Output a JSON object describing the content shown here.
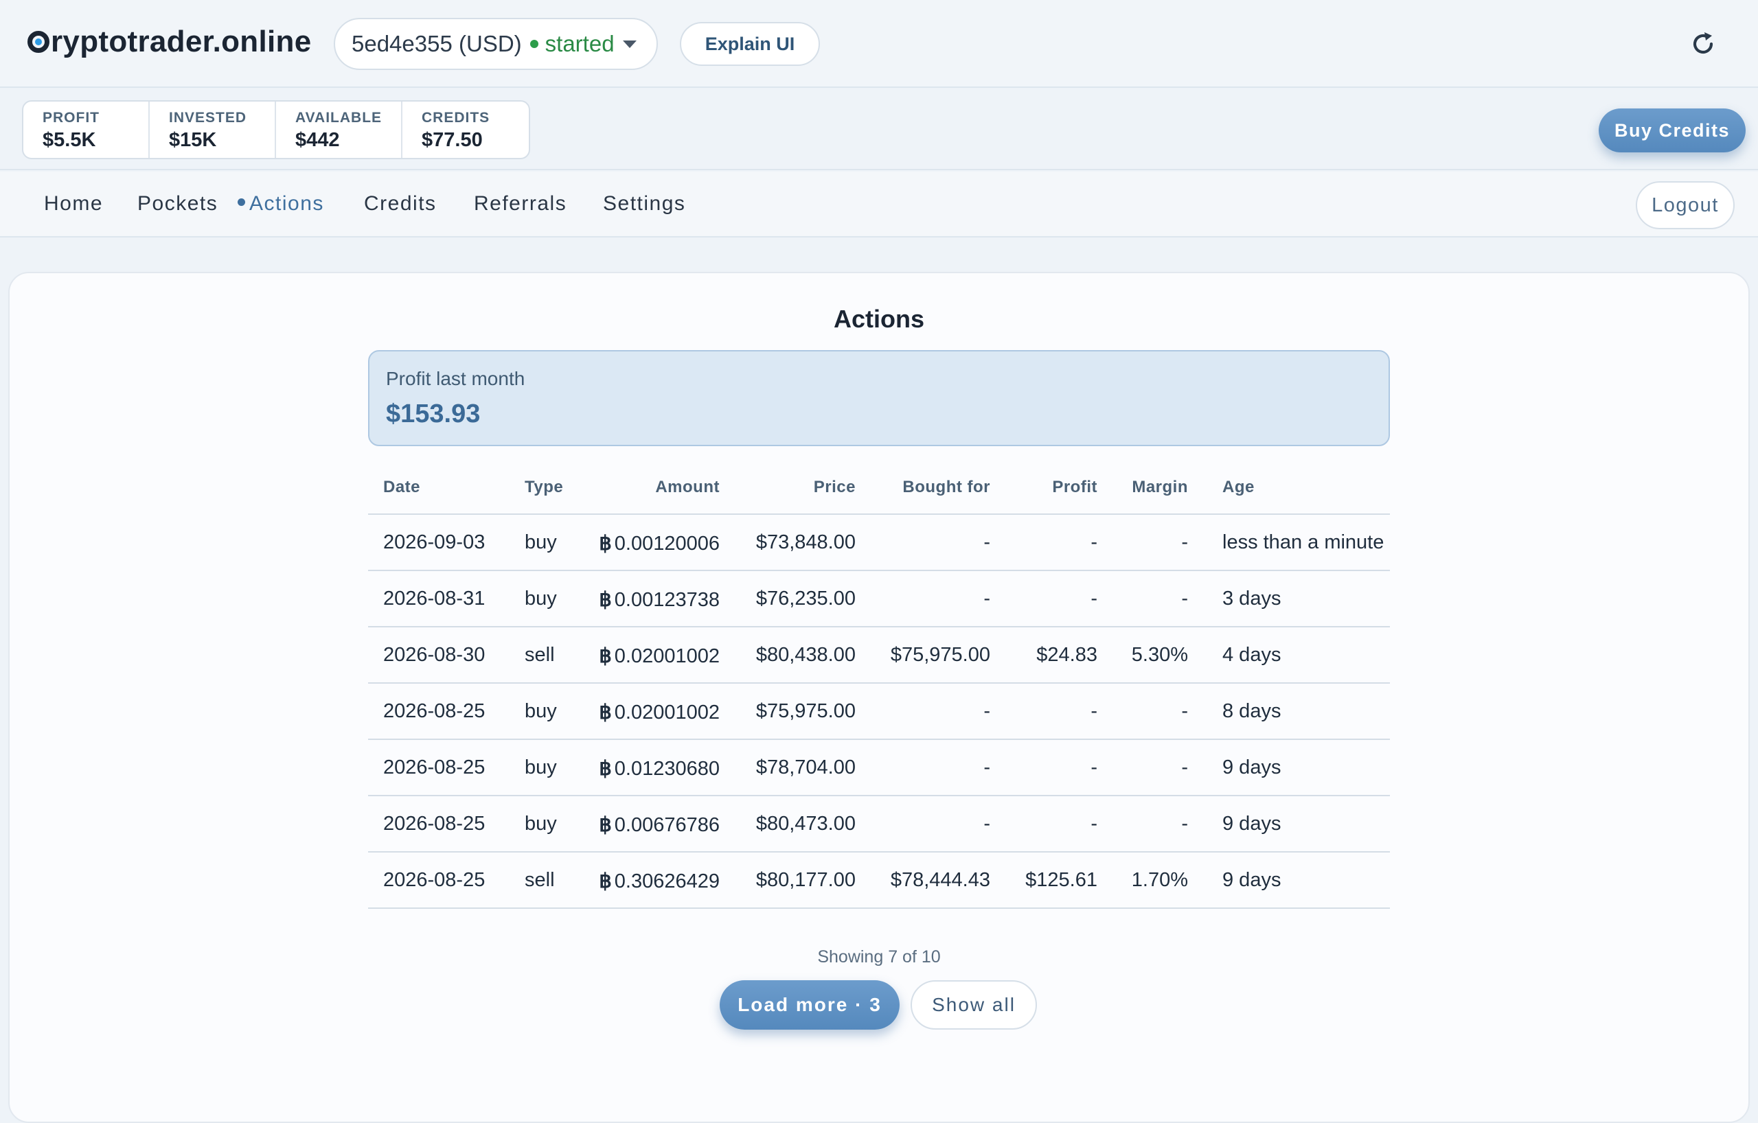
{
  "header": {
    "logo_text": "ryptotrader.online",
    "pocket": {
      "id": "5ed4e355 (USD)",
      "status": "started"
    },
    "explain_label": "Explain UI"
  },
  "stats": [
    {
      "label": "PROFIT",
      "value": "$5.5K"
    },
    {
      "label": "INVESTED",
      "value": "$15K"
    },
    {
      "label": "AVAILABLE",
      "value": "$442"
    },
    {
      "label": "CREDITS",
      "value": "$77.50"
    }
  ],
  "buy_credits_label": "Buy Credits",
  "nav": {
    "items": [
      {
        "label": "Home"
      },
      {
        "label": "Pockets"
      },
      {
        "label": "Actions",
        "active": true
      },
      {
        "label": "Credits"
      },
      {
        "label": "Referrals"
      },
      {
        "label": "Settings"
      }
    ],
    "logout_label": "Logout"
  },
  "main": {
    "title": "Actions",
    "profit_label": "Profit last month",
    "profit_value": "$153.93",
    "columns": [
      "Date",
      "Type",
      "Amount",
      "Price",
      "Bought for",
      "Profit",
      "Margin",
      "Age"
    ],
    "currency_symbol": "฿",
    "rows": [
      {
        "date": "2026-09-03",
        "type": "buy",
        "amount": "0.00120006",
        "price": "$73,848.00",
        "bought_for": "-",
        "profit": "-",
        "margin": "-",
        "age": "less than a minute"
      },
      {
        "date": "2026-08-31",
        "type": "buy",
        "amount": "0.00123738",
        "price": "$76,235.00",
        "bought_for": "-",
        "profit": "-",
        "margin": "-",
        "age": "3 days"
      },
      {
        "date": "2026-08-30",
        "type": "sell",
        "amount": "0.02001002",
        "price": "$80,438.00",
        "bought_for": "$75,975.00",
        "profit": "$24.83",
        "margin": "5.30%",
        "age": "4 days"
      },
      {
        "date": "2026-08-25",
        "type": "buy",
        "amount": "0.02001002",
        "price": "$75,975.00",
        "bought_for": "-",
        "profit": "-",
        "margin": "-",
        "age": "8 days"
      },
      {
        "date": "2026-08-25",
        "type": "buy",
        "amount": "0.01230680",
        "price": "$78,704.00",
        "bought_for": "-",
        "profit": "-",
        "margin": "-",
        "age": "9 days"
      },
      {
        "date": "2026-08-25",
        "type": "buy",
        "amount": "0.00676786",
        "price": "$80,473.00",
        "bought_for": "-",
        "profit": "-",
        "margin": "-",
        "age": "9 days"
      },
      {
        "date": "2026-08-25",
        "type": "sell",
        "amount": "0.30626429",
        "price": "$80,177.00",
        "bought_for": "$78,444.43",
        "profit": "$125.61",
        "margin": "1.70%",
        "age": "9 days"
      }
    ],
    "showing_text": "Showing 7 of 10",
    "load_more_label": "Load more · 3",
    "show_all_label": "Show all"
  },
  "colors": {
    "accent": "#5b8fc2",
    "status_green": "#2a8a45",
    "profit_box_bg": "#dbe8f4"
  },
  "icons": {
    "refresh": "refresh-icon",
    "dropdown": "chevron-down-icon"
  }
}
